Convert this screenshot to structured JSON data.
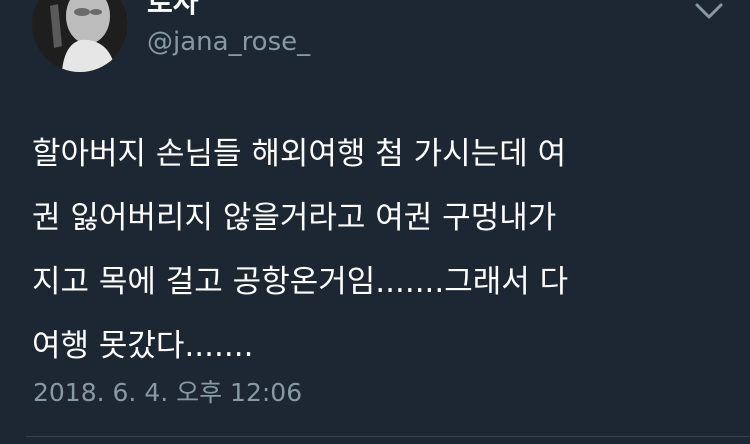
{
  "user": {
    "display_name": "로사",
    "handle": "@jana_rose_"
  },
  "tweet": {
    "lines": [
      "할아버지 손님들 해외여행 첨 가시는데 여",
      "권 잃어버리지 않을거라고 여권 구멍내가",
      "지고 목에 걸고 공항온거임.......그래서 다",
      "여행 못갔다......."
    ],
    "timestamp": "2018. 6. 4. 오후 12:06"
  },
  "icons": {
    "avatar": "profile-photo",
    "menu": "chevron-down-icon"
  },
  "colors": {
    "background": "#1c2733",
    "primary_text": "#ffffff",
    "secondary_text": "#8899a6",
    "divider": "#38444d"
  }
}
